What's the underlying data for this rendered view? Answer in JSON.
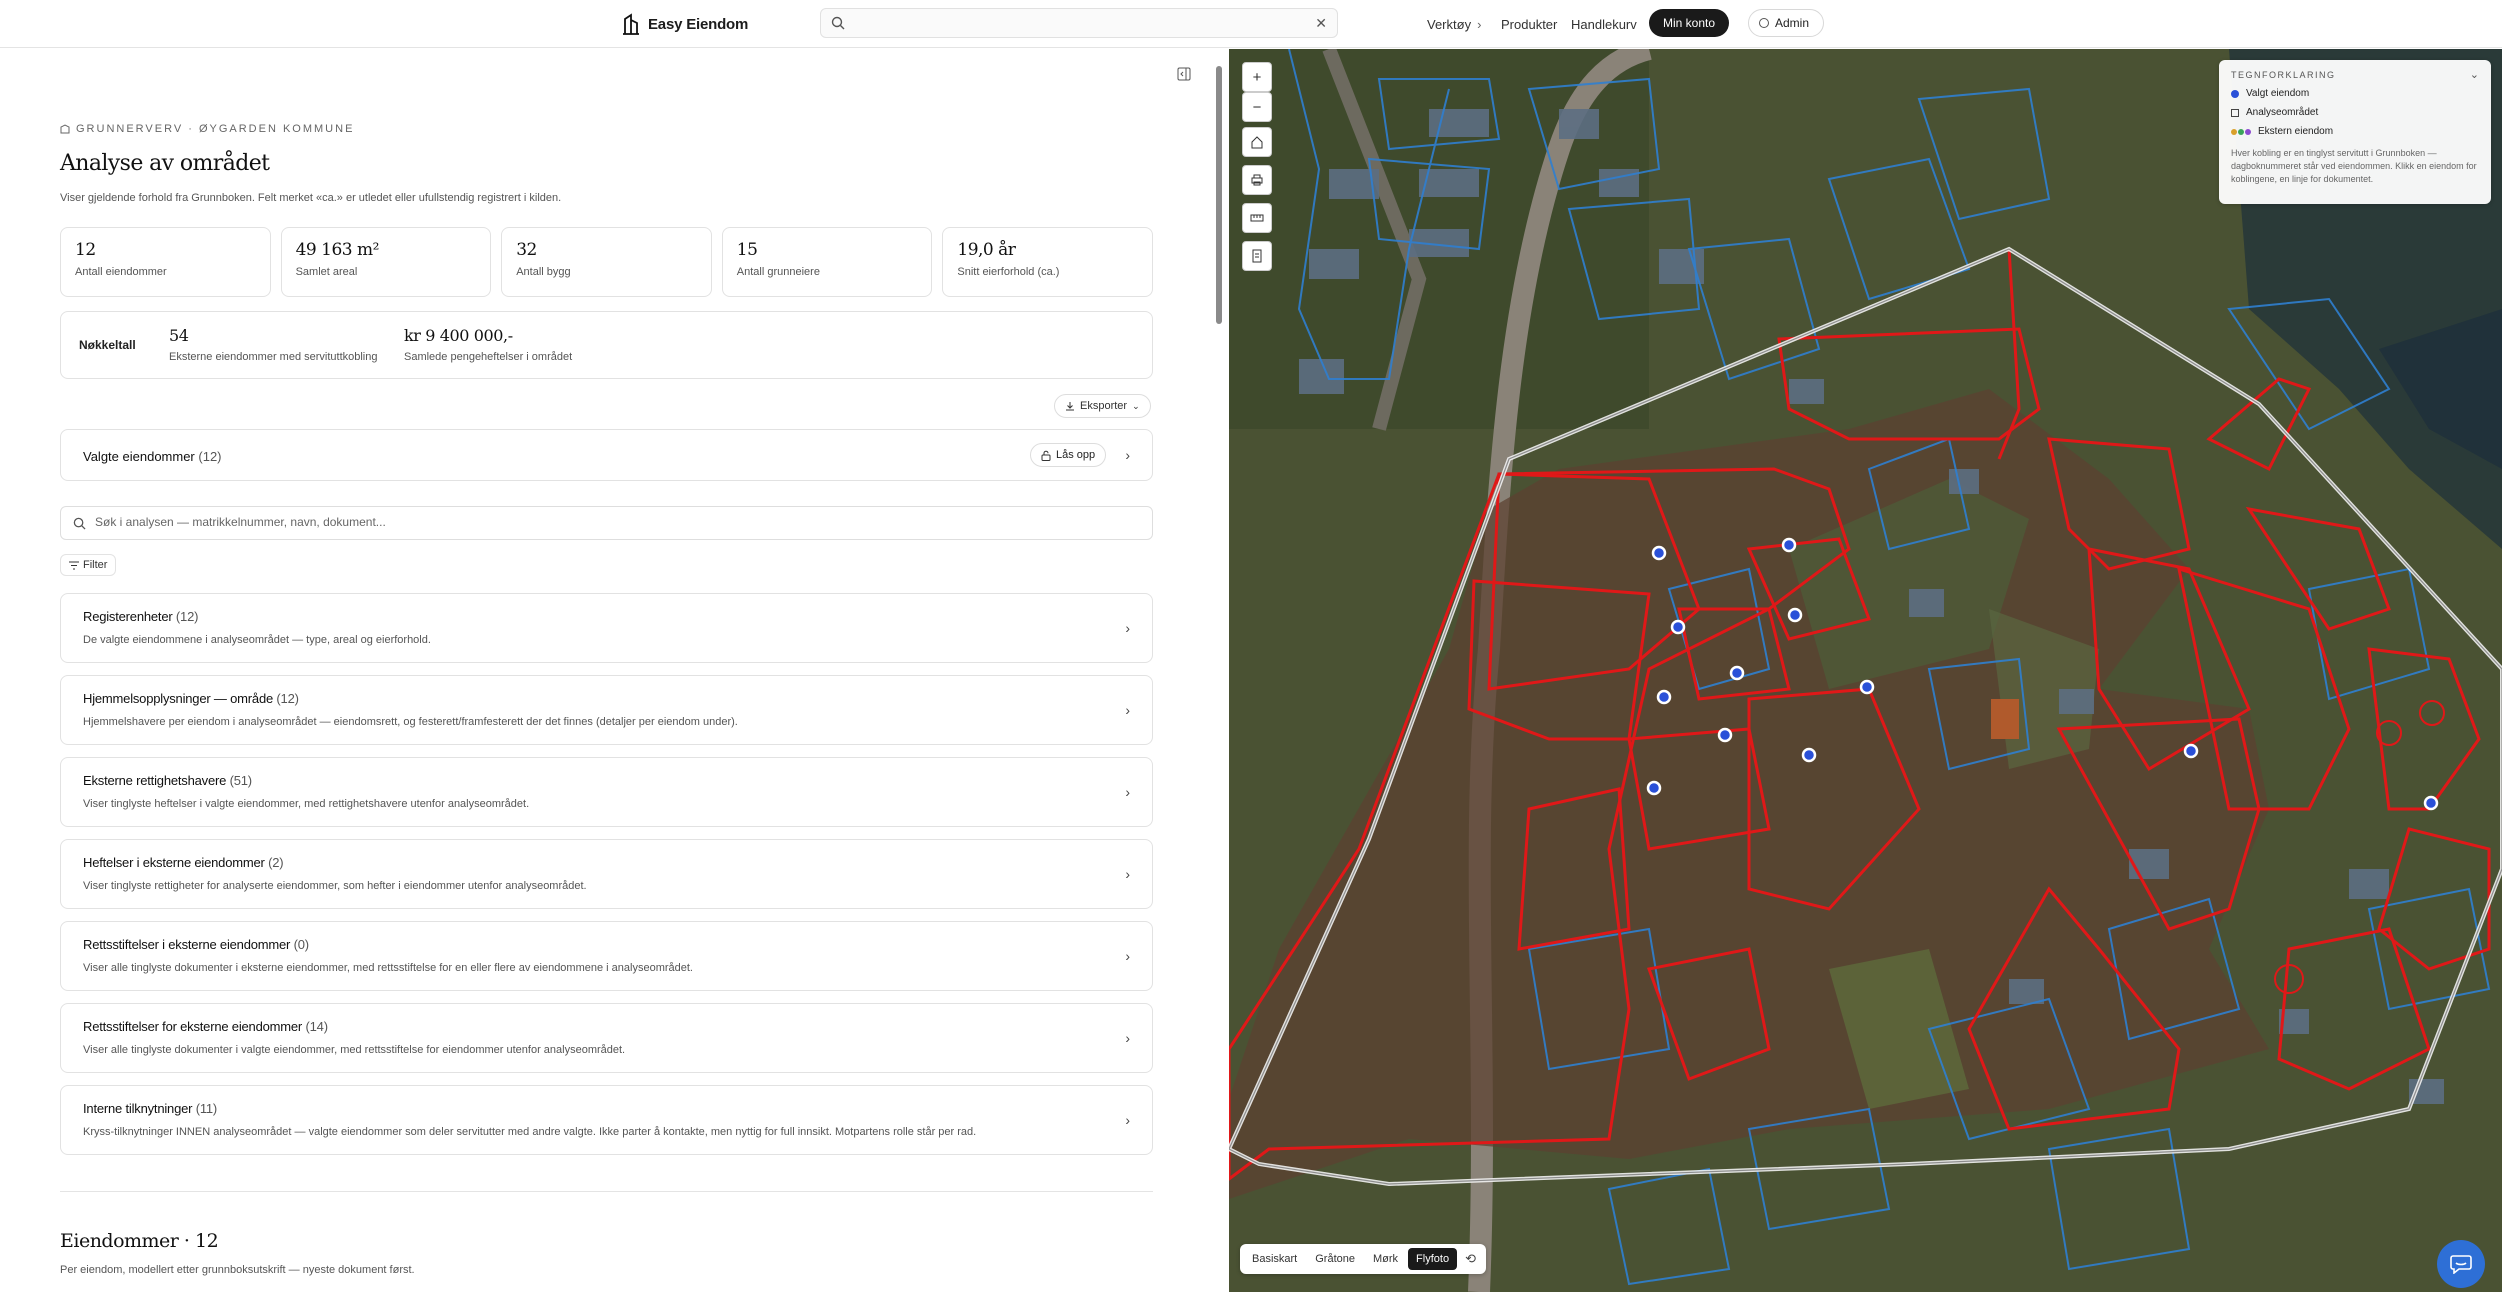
{
  "header": {
    "logo_text": "Easy Eiendom",
    "search_placeholder": "",
    "nav": {
      "verktoy": "Verktøy",
      "produkter": "Produkter",
      "handlekurv": "Handlekurv"
    },
    "min_konto": "Min konto",
    "admin": "Admin"
  },
  "analysis": {
    "eyebrow": "GRUNNERVERV · ØYGARDEN KOMMUNE",
    "title": "Analyse av området",
    "subtitle": "Viser gjeldende forhold fra Grunnboken. Felt merket «ca.» er utledet eller ufullstendig registrert i kilden.",
    "stats": [
      {
        "value": "12",
        "label": "Antall eiendommer"
      },
      {
        "value": "49 163 m²",
        "label": "Samlet areal"
      },
      {
        "value": "32",
        "label": "Antall bygg"
      },
      {
        "value": "15",
        "label": "Antall grunneiere"
      },
      {
        "value": "19,0 år",
        "label": "Snitt eierforhold (ca.)"
      }
    ],
    "nokkeltall": {
      "title": "Nøkkeltall",
      "items": [
        {
          "value": "54",
          "label": "Eksterne eiendommer med servituttkobling"
        },
        {
          "value": "kr 9 400 000,-",
          "label": "Samlede pengeheftelser i området"
        }
      ]
    },
    "export_label": "Eksporter",
    "valgte": {
      "label": "Valgte eiendommer",
      "count": "(12)",
      "unlock": "Lås opp"
    },
    "search_placeholder": "Søk i analysen — matrikkelnummer, navn, dokument...",
    "filter_label": "Filter",
    "sections": [
      {
        "title": "Registerenheter",
        "count": "(12)",
        "desc": "De valgte eiendommene i analyseområdet — type, areal og eierforhold."
      },
      {
        "title": "Hjemmelsopplysninger — område",
        "count": "(12)",
        "desc": "Hjemmelshavere per eiendom i analyseområdet — eiendomsrett, og festerett/framfesterett der det finnes (detaljer per eiendom under)."
      },
      {
        "title": "Eksterne rettighetshavere",
        "count": "(51)",
        "desc": "Viser tinglyste heftelser i valgte eiendommer, med rettighetshavere utenfor analyseområdet."
      },
      {
        "title": "Heftelser i eksterne eiendommer",
        "count": "(2)",
        "desc": "Viser tinglyste rettigheter for analyserte eiendommer, som hefter i eiendommer utenfor analyseområdet."
      },
      {
        "title": "Rettsstiftelser i eksterne eiendommer",
        "count": "(0)",
        "desc": "Viser alle tinglyste dokumenter i eksterne eiendommer, med rettsstiftelse for en eller flere av eiendommene i analyseområdet."
      },
      {
        "title": "Rettsstiftelser for eksterne eiendommer",
        "count": "(14)",
        "desc": "Viser alle tinglyste dokumenter i valgte eiendommer, med rettsstiftelse for eiendommer utenfor analyseområdet."
      },
      {
        "title": "Interne tilknytninger",
        "count": "(11)",
        "desc": "Kryss-tilknytninger INNEN analyseområdet — valgte eiendommer som deler servitutter med andre valgte. Ikke parter å kontakte, men nyttig for full innsikt. Motpartens rolle står per rad."
      }
    ],
    "eiendommer_title": "Eiendommer · 12",
    "eiendommer_sub": "Per eiendom, modellert etter grunnboksutskrift — nyeste dokument først."
  },
  "map": {
    "legend": {
      "title": "TEGNFORKLARING",
      "items": [
        "Valgt eiendom",
        "Analyseområdet",
        "Ekstern eiendom"
      ],
      "note": "Hver kobling er en tinglyst servitutt i Grunnboken — dagboknummeret står ved eiendommen. Klikk en eiendom for koblingene, en linje for dokumentet."
    },
    "layers": [
      "Basiskart",
      "Gråtone",
      "Mørk",
      "Flyfoto"
    ],
    "active_layer": "Flyfoto",
    "colors": {
      "selected": "#2a50d8",
      "analysis": "#ffffff",
      "parcel_selected": "#e01818",
      "parcel_other": "#2f7fd0"
    }
  }
}
